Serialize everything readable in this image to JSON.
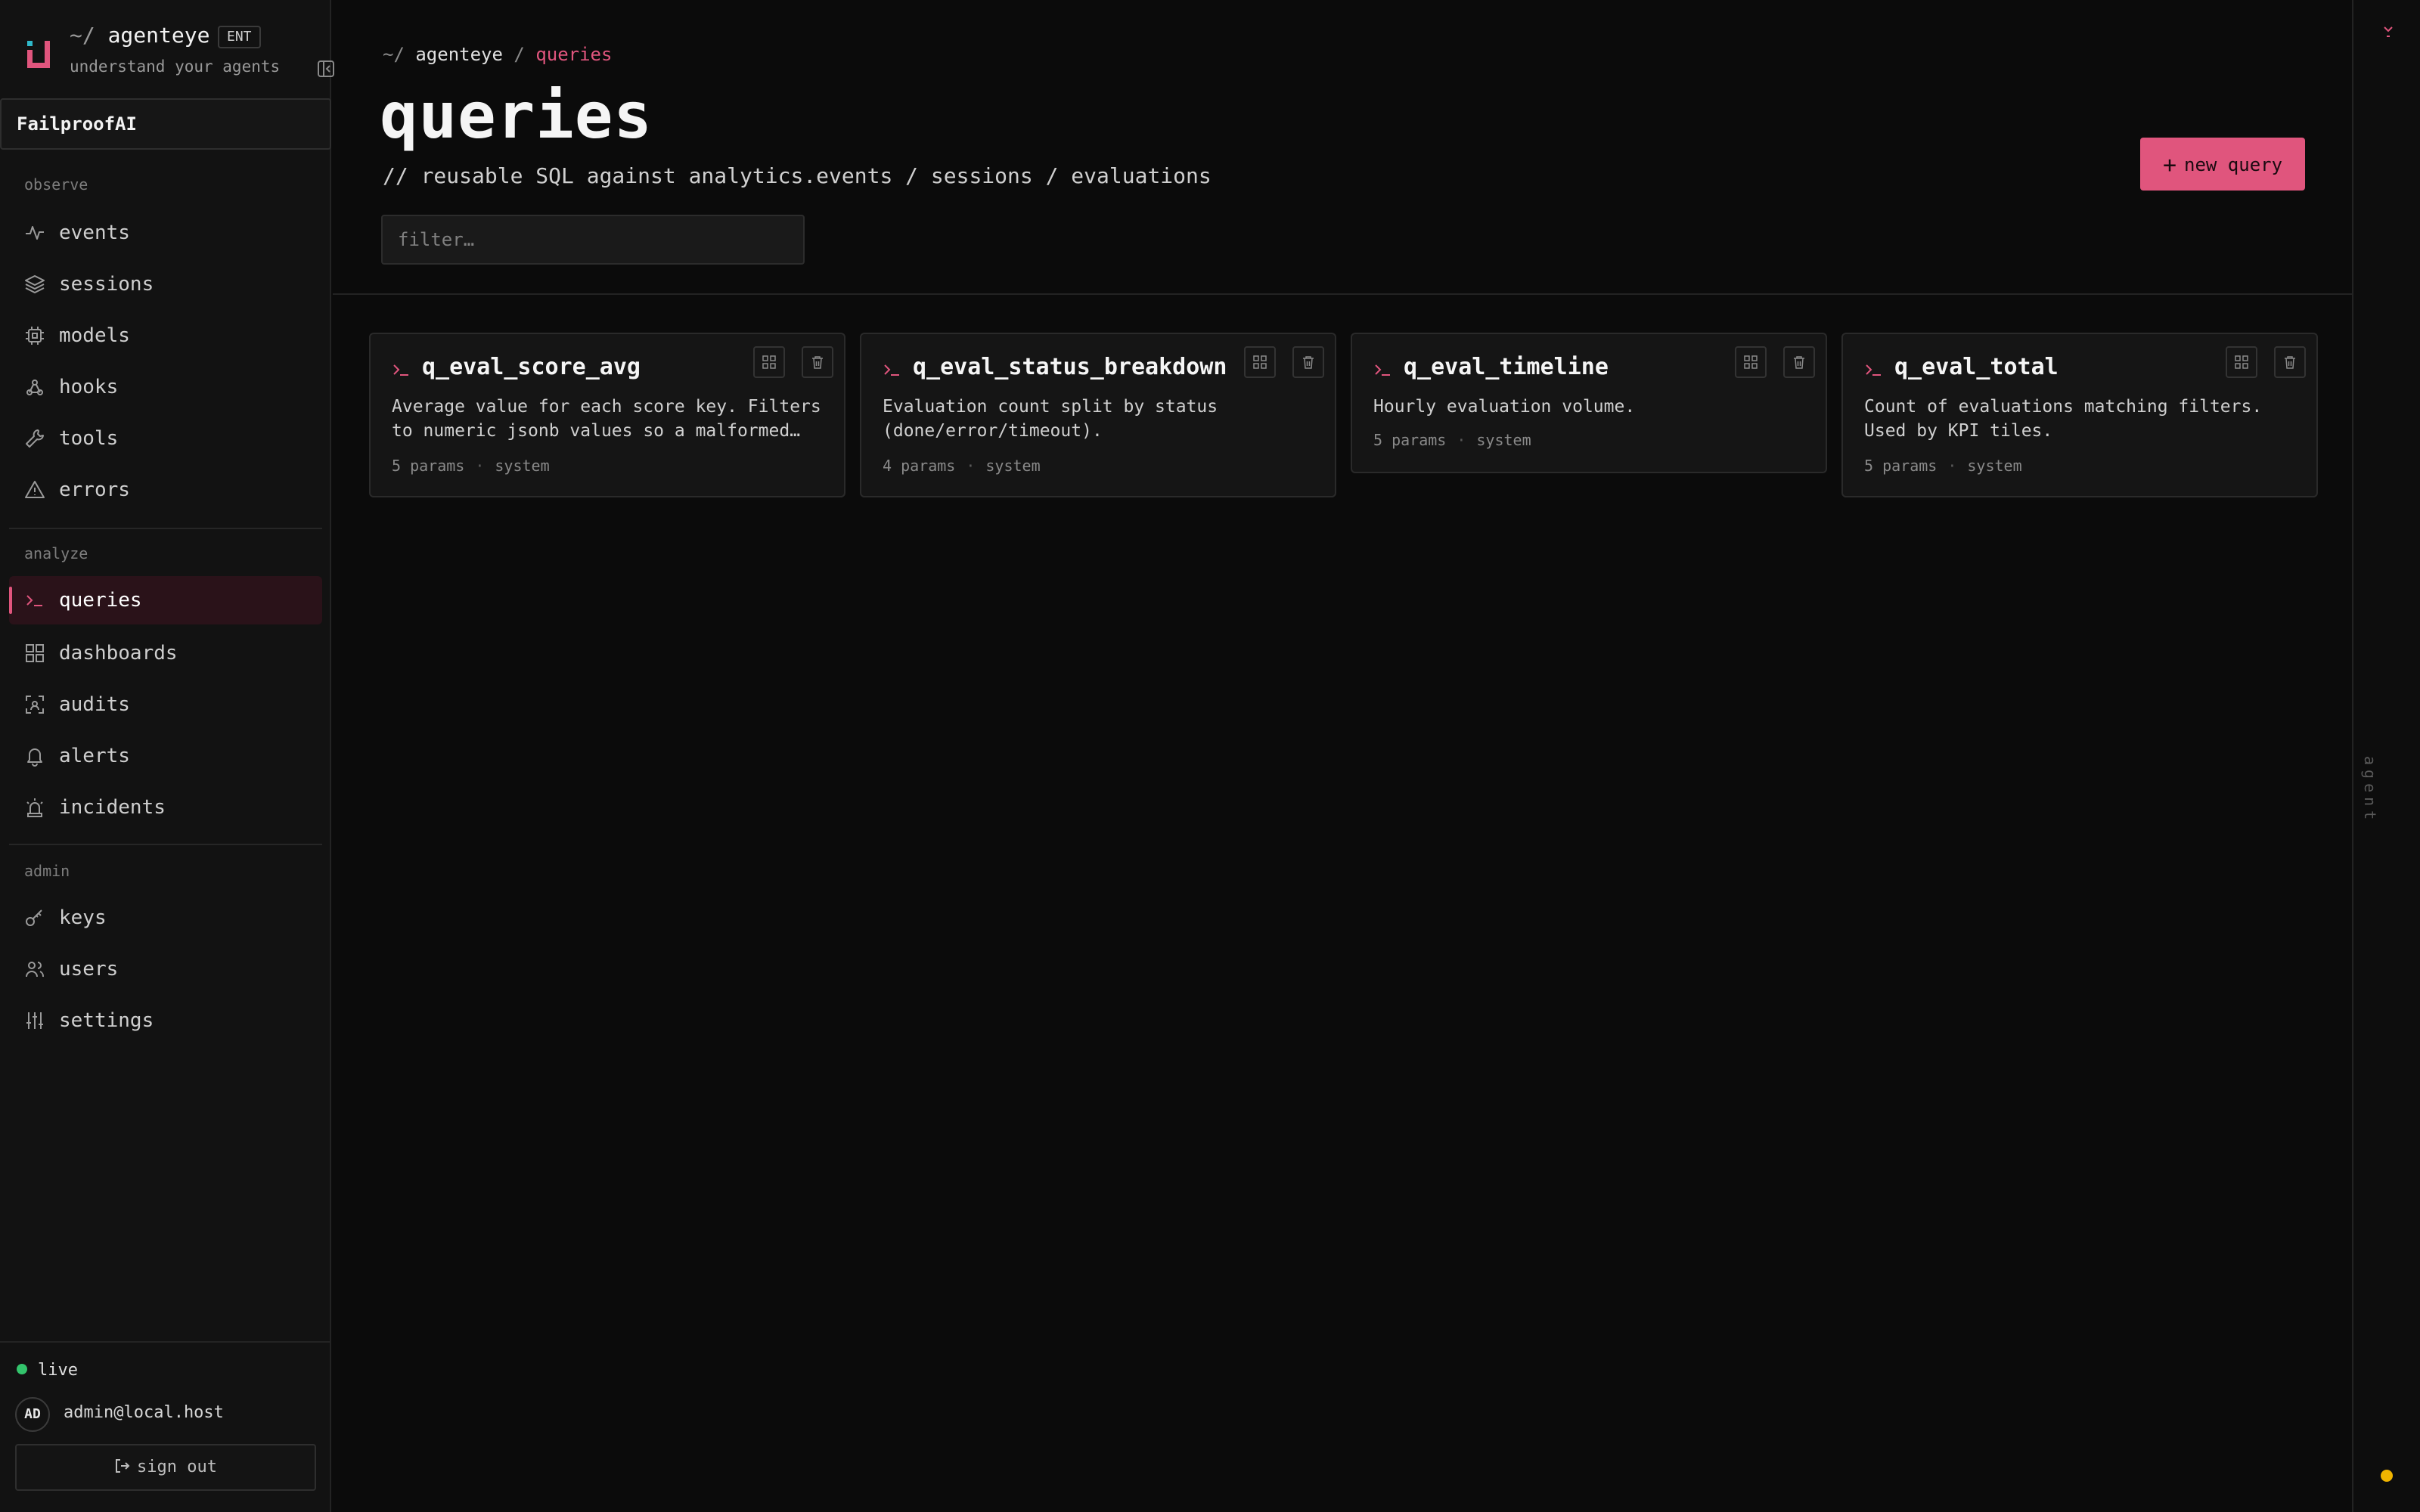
{
  "brand": {
    "tilde": "~/",
    "name": "agenteye",
    "badge": "ENT",
    "tagline": "understand your agents"
  },
  "org": "FailproofAI",
  "sidebar": {
    "sections": [
      {
        "label": "observe"
      },
      {
        "label": "analyze"
      },
      {
        "label": "admin"
      }
    ],
    "items": [
      {
        "label": "events",
        "icon": "activity-icon"
      },
      {
        "label": "sessions",
        "icon": "layers-icon"
      },
      {
        "label": "models",
        "icon": "cpu-icon"
      },
      {
        "label": "hooks",
        "icon": "webhook-icon"
      },
      {
        "label": "tools",
        "icon": "wrench-icon"
      },
      {
        "label": "errors",
        "icon": "warning-icon"
      },
      {
        "label": "queries",
        "icon": "terminal-icon",
        "active": true
      },
      {
        "label": "dashboards",
        "icon": "grid-icon"
      },
      {
        "label": "audits",
        "icon": "scan-icon"
      },
      {
        "label": "alerts",
        "icon": "bell-icon"
      },
      {
        "label": "incidents",
        "icon": "siren-icon"
      },
      {
        "label": "keys",
        "icon": "key-icon"
      },
      {
        "label": "users",
        "icon": "users-icon"
      },
      {
        "label": "settings",
        "icon": "sliders-icon"
      }
    ]
  },
  "footer": {
    "status": "live",
    "avatar": "AD",
    "email": "admin@local.host",
    "signout": "sign out"
  },
  "header": {
    "crumb_tilde": "~/",
    "crumb_root": "agenteye",
    "crumb_sep": "/",
    "crumb_current": "queries",
    "title": "queries",
    "subtitle": "// reusable SQL against analytics.events / sessions / evaluations",
    "filter_placeholder": "filter…",
    "new_button": "new query",
    "new_button_plus": "+"
  },
  "queries": [
    {
      "name": "q_eval_score_avg",
      "description": "Average value for each score key. Filters to numeric jsonb values so a malformed…",
      "params": "5 params",
      "owner": "system"
    },
    {
      "name": "q_eval_status_breakdown",
      "description": "Evaluation count split by status (done/error/timeout).",
      "params": "4 params",
      "owner": "system"
    },
    {
      "name": "q_eval_timeline",
      "description": "Hourly evaluation volume.",
      "params": "5 params",
      "owner": "system"
    },
    {
      "name": "q_eval_total",
      "description": "Count of evaluations matching filters. Used by KPI tiles.",
      "params": "5 params",
      "owner": "system"
    }
  ],
  "rail": {
    "label": "agent"
  },
  "colors": {
    "accent": "#e0557d",
    "live": "#33c46c",
    "background": "#0b0b0b",
    "indicator": "#f0b400"
  }
}
